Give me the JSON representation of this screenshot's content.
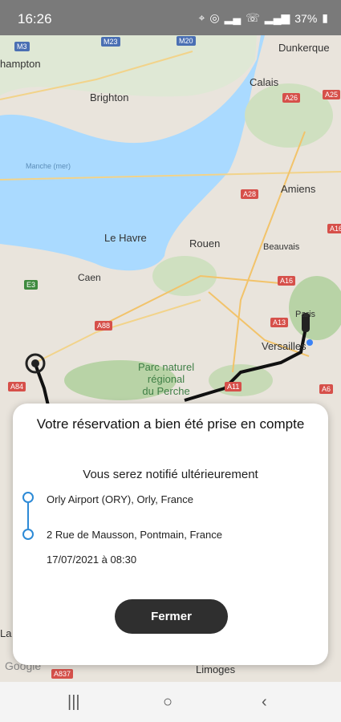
{
  "status_bar": {
    "time": "16:26",
    "battery": "37%"
  },
  "map": {
    "cities": {
      "hampton": "hampton",
      "brighton": "Brighton",
      "dunkerque": "Dunkerque",
      "calais": "Calais",
      "amiens": "Amiens",
      "le_havre": "Le Havre",
      "rouen": "Rouen",
      "beauvais": "Beauvais",
      "caen": "Caen",
      "paris": "Paris",
      "versailles": "Versailles",
      "limoges": "Limoges",
      "la": "La"
    },
    "sea": "Manche (mer)",
    "park": [
      "Parc naturel",
      "régional",
      "du Perche"
    ],
    "roads": {
      "m3": "M3",
      "m23": "M23",
      "m20": "M20",
      "a26": "A26",
      "a25": "A25",
      "a16_north": "A16",
      "a28": "A28",
      "a16": "A16",
      "a13": "A13",
      "a88": "A88",
      "a84": "A84",
      "a11": "A11",
      "a6": "A6",
      "a837": "A837",
      "e3": "E3"
    },
    "attribution": "Google"
  },
  "dialog": {
    "title": "Votre réservation a bien été prise en compte",
    "subtitle": "Vous serez notifié ultérieurement",
    "origin": "Orly Airport (ORY), Orly, France",
    "destination": "2 Rue de Mausson, Pontmain, France",
    "date": "17/07/2021 à 08:30",
    "close_label": "Fermer"
  },
  "colors": {
    "route": "#2d8ad6",
    "button": "#2f2f2f",
    "sea": "#aadaff"
  },
  "nav": {
    "recent": "|||",
    "home": "○",
    "back": "‹"
  }
}
